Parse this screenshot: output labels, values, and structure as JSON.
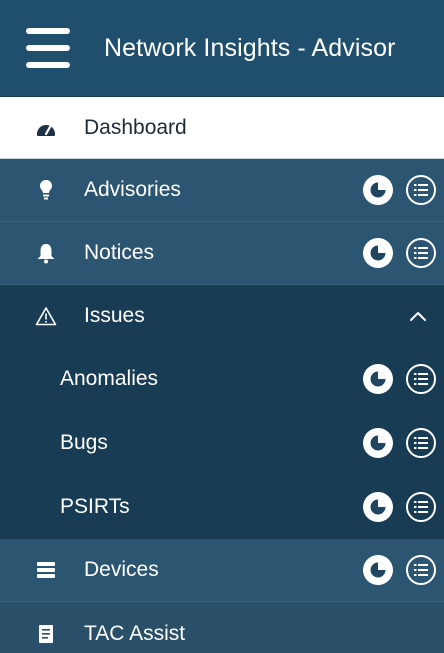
{
  "header": {
    "title": "Network Insights - Advisor"
  },
  "nav": {
    "dashboard": {
      "label": "Dashboard"
    },
    "advisories": {
      "label": "Advisories"
    },
    "notices": {
      "label": "Notices"
    },
    "issues": {
      "label": "Issues",
      "children": [
        {
          "label": "Anomalies"
        },
        {
          "label": "Bugs"
        },
        {
          "label": "PSIRTs"
        }
      ]
    },
    "devices": {
      "label": "Devices"
    },
    "tac": {
      "label": "TAC Assist"
    }
  },
  "icons": {
    "menu": "hamburger-icon",
    "dashboard": "gauge-icon",
    "advisories": "lightbulb-icon",
    "notices": "bell-icon",
    "issues": "warning-icon",
    "devices": "stack-icon",
    "tac": "document-icon",
    "chart": "pie-chart-icon",
    "list": "list-icon",
    "collapse": "chevron-up-icon"
  },
  "colors": {
    "header_bg": "#1f4f6c",
    "nav_bg": "#2b5571",
    "group_bg": "#193c55",
    "active_bg": "#ffffff",
    "text": "#ffffff",
    "active_text": "#1d2b36"
  }
}
